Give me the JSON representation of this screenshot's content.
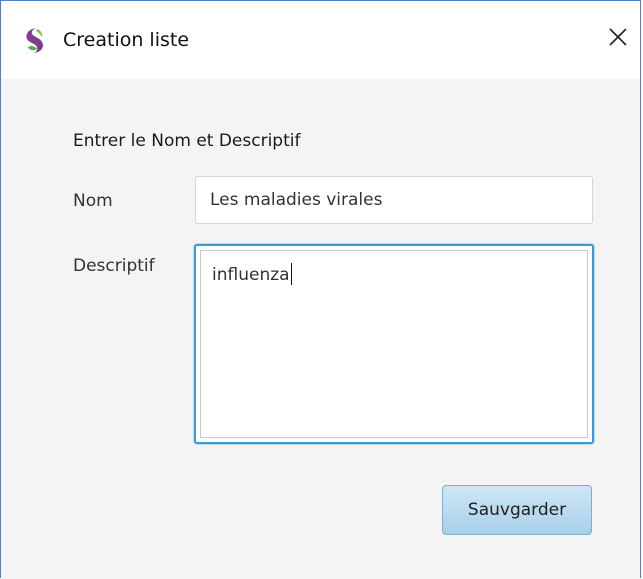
{
  "window": {
    "title": "Creation liste",
    "app_icon": "app-logo-icon",
    "close_icon": "close-icon"
  },
  "form": {
    "heading": "Entrer le Nom et Descriptif",
    "nom": {
      "label": "Nom",
      "value": "Les maladies virales"
    },
    "descriptif": {
      "label": "Descriptif",
      "value": "influenza"
    },
    "save_label": "Sauvgarder"
  },
  "colors": {
    "accent": "#3d9ad6",
    "button": "#a9d0ea",
    "window_border": "#4a7fd1"
  }
}
